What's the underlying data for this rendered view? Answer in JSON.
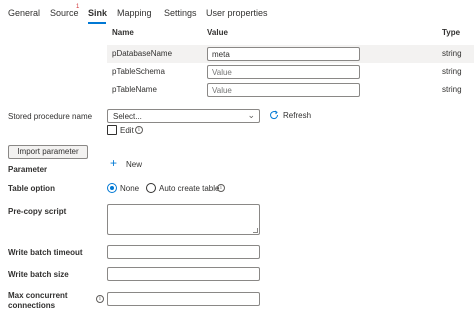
{
  "tabs": [
    {
      "label": "General"
    },
    {
      "label": "Source"
    },
    {
      "label": "Sink"
    },
    {
      "label": "Mapping"
    },
    {
      "label": "Settings"
    },
    {
      "label": "User properties"
    }
  ],
  "source_badge": "1",
  "table": {
    "headers": {
      "name": "Name",
      "value": "Value",
      "type": "Type"
    },
    "rows": [
      {
        "name": "pDatabaseName",
        "value": "meta",
        "placeholder": "",
        "type": "string"
      },
      {
        "name": "pTableSchema",
        "value": "",
        "placeholder": "Value",
        "type": "string"
      },
      {
        "name": "pTableName",
        "value": "",
        "placeholder": "Value",
        "type": "string"
      }
    ]
  },
  "stored_procedure": {
    "label": "Stored procedure name",
    "select_value": "Select...",
    "refresh_label": "Refresh",
    "edit_label": "Edit"
  },
  "import_parameter_label": "Import parameter",
  "parameter": {
    "label": "Parameter",
    "new_label": "New"
  },
  "table_option": {
    "label": "Table option",
    "options": [
      {
        "label": "None",
        "checked": true
      },
      {
        "label": "Auto create table",
        "checked": false
      }
    ]
  },
  "pre_copy_script": {
    "label": "Pre-copy script"
  },
  "write_batch_timeout": {
    "label": "Write batch timeout"
  },
  "write_batch_size": {
    "label": "Write batch size"
  },
  "max_concurrent": {
    "label_line1": "Max concurrent",
    "label_line2": "connections"
  },
  "colors": {
    "accent": "#0078d4",
    "badge": "#d13438",
    "row_highlight": "#f3f2f1"
  }
}
